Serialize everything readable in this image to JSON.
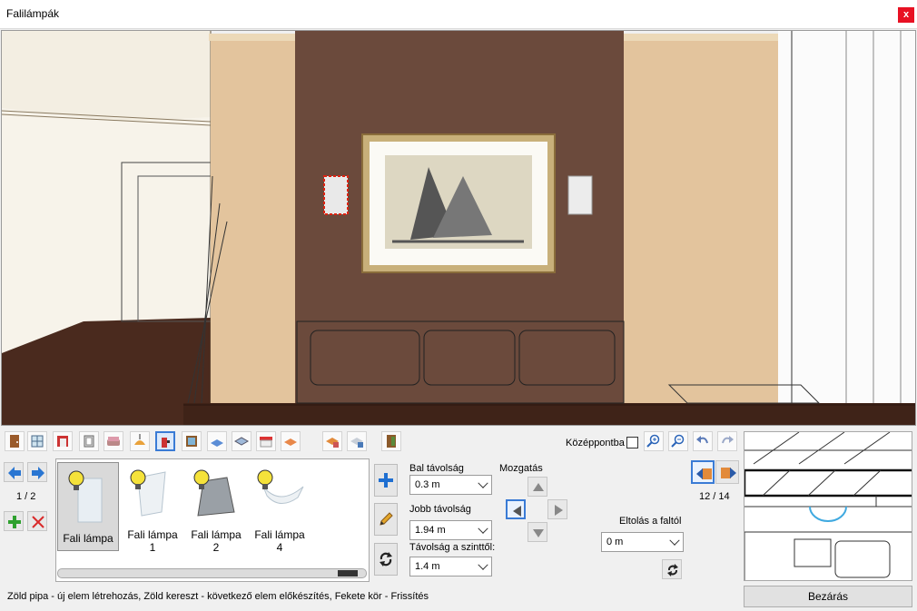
{
  "window": {
    "title": "Falilámpák",
    "close_glyph": "x"
  },
  "toolbar": {
    "icons": [
      "door-icon",
      "window-icon",
      "wall-niche-icon",
      "opening-icon",
      "sofa-icon",
      "ceiling-lamp-icon",
      "wall-lamp-icon",
      "picture-icon",
      "carpet-icon",
      "table-icon",
      "awning-icon",
      "bed-icon",
      "tile-wall-icon",
      "tile-floor-icon",
      "wardrobe-icon"
    ],
    "center_checkbox_label": "Középpontba",
    "zoom_in": "zoom-in-icon",
    "zoom_out": "zoom-out-icon",
    "undo": "undo-icon",
    "redo": "redo-icon"
  },
  "left_nav": {
    "page_indicator": "1 / 2"
  },
  "items": [
    {
      "name": "Fali lámpa",
      "selected": true
    },
    {
      "name": "Fali lámpa",
      "sub": "1"
    },
    {
      "name": "Fali lámpa",
      "sub": "2"
    },
    {
      "name": "Fali lámpa",
      "sub": "4"
    }
  ],
  "params": {
    "bal_label": "Bal távolság",
    "bal_value": "0.3 m",
    "jobb_label": "Jobb távolság",
    "jobb_value": "1.94 m",
    "szint_label": "Távolság a szinttől:",
    "szint_value": "1.4 m",
    "mozgatas_label": "Mozgatás",
    "eltolas_label": "Eltolás a faltól",
    "eltolas_value": "0 m"
  },
  "right_nav": {
    "counter": "12 / 14"
  },
  "status": "Zöld pipa - új elem létrehozás, Zöld kereszt - következő elem előkészítés, Fekete kör - Frissítés",
  "close_button": "Bezárás"
}
